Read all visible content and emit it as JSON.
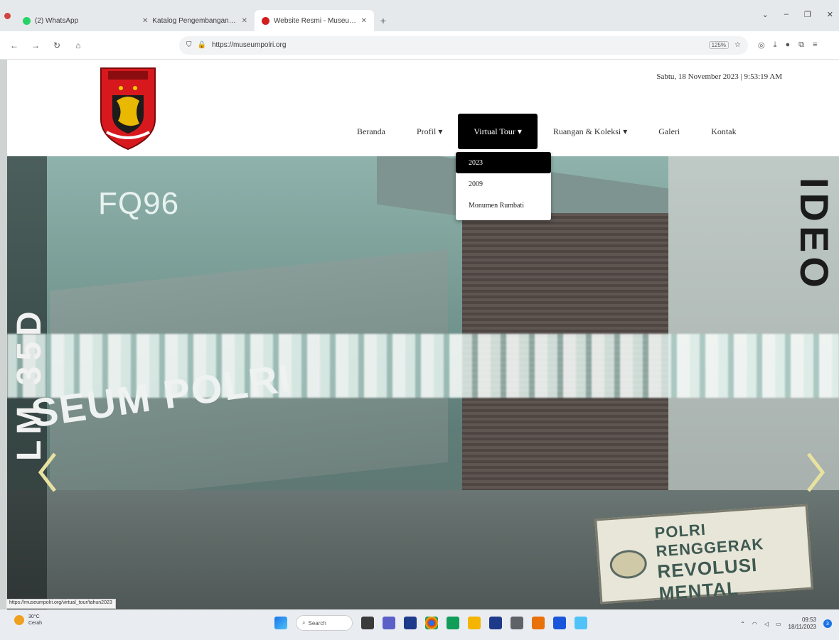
{
  "browser": {
    "tabs": [
      {
        "label": "(2) WhatsApp",
        "color": "#25d366",
        "active": false
      },
      {
        "label": "Katalog Pengembangan Objek Bud",
        "color": "#9aa0a6",
        "active": false
      },
      {
        "label": "Website Resmi - Museum Polri",
        "color": "#d11f1f",
        "active": true
      }
    ],
    "url": "https://museumpolri.org",
    "zoom": "125%",
    "status_url": "https://museumpolri.org/virtual_tour/tahun2023"
  },
  "site": {
    "datetime": "Sabtu, 18 November 2023 | 9:53:19 AM",
    "nav": [
      {
        "label": "Beranda",
        "active": false
      },
      {
        "label": "Profil ▾",
        "active": false
      },
      {
        "label": "Virtual Tour ▾",
        "active": true
      },
      {
        "label": "Ruangan & Koleksi ▾",
        "active": false
      },
      {
        "label": "Galeri",
        "active": false
      },
      {
        "label": "Kontak",
        "active": false
      }
    ],
    "dropdown": [
      {
        "label": "2023",
        "hover": true
      },
      {
        "label": "2009",
        "hover": false
      },
      {
        "label": "Monumen Rumbati",
        "hover": false
      }
    ]
  },
  "hero": {
    "overlay_word": "FQ96",
    "sign_text": "SEUM POLRI",
    "left_vertical": "LM 35D",
    "right_vertical": "IDEO",
    "banner_line1": "POLRI RENGGERAK",
    "banner_line2": "REVOLUSI MENTAL"
  },
  "taskbar": {
    "weather_temp": "30°C",
    "weather_desc": "Cerah",
    "search_label": "Search",
    "time": "09:53",
    "date": "18/11/2023",
    "notifications": "3",
    "app_colors": [
      "#1a73e8",
      "#1e8e3e",
      "#5b5fc7",
      "#d93025",
      "#f4b400",
      "#1a73e8",
      "#e8710a",
      "#1e3a8a",
      "#0f9d58"
    ]
  },
  "colors": {
    "nav_active_bg": "#000000",
    "logo_red": "#d7191e",
    "arrow": "#e8e2a0"
  }
}
